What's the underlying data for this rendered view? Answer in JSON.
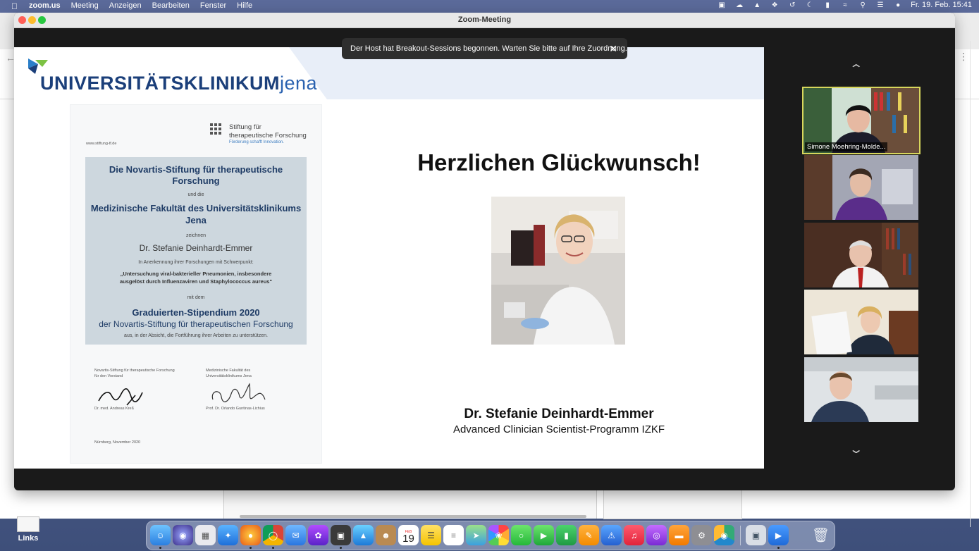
{
  "menubar": {
    "app_name": "zoom.us",
    "menus": [
      "Meeting",
      "Anzeigen",
      "Bearbeiten",
      "Fenster",
      "Hilfe"
    ],
    "clock": "Fr. 19. Feb.  15:41"
  },
  "desktop": {
    "icon_label": "Links"
  },
  "zoom": {
    "window_title": "Zoom-Meeting",
    "banner_text": "Der Host hat Breakout-Sessions begonnen. Warten Sie bitte auf Ihre Zuordnung.",
    "slide": {
      "logo_main": "UNIVERSITÄTSKLINIKUM",
      "logo_city": "jena",
      "headline": "Herzlichen Glückwunsch!",
      "person_name": "Dr. Stefanie Deinhardt-Emmer",
      "program": "Advanced Clinician Scientist-Programm IZKF",
      "certificate": {
        "foundation_line1": "Stiftung für",
        "foundation_line2": "therapeutische Forschung",
        "foundation_slogan": "Förderung schafft Innovation.",
        "website": "www.stiftung-tf.de",
        "title": "Die Novartis-Stiftung für therapeutische Forschung",
        "und_die": "und die",
        "faculty": "Medizinische Fakultät des Universitätsklinikums Jena",
        "zeichnen": "zeichnen",
        "recipient": "Dr. Stefanie Deinhardt-Emmer",
        "recognition": "In Anerkennung ihrer Forschungen mit Schwerpunkt:",
        "topic_line1": "„Untersuchung viral-bakterieller Pneumonien, insbesondere",
        "topic_line2": "ausgelöst durch Influenzaviren und Staphylococcus aureus\"",
        "mit_dem": "mit dem",
        "award": "Graduierten-Stipendium 2020",
        "award_by": "der Novartis-Stiftung für therapeutischen Forschung",
        "intent": "aus, in der Absicht, die Fortführung ihrer Arbeiten zu unterstützen.",
        "sig_left_line1": "Novartis-Stiftung für therapeutische Forschung",
        "sig_left_line2": "für den Vorstand",
        "sig_left_name": "Dr. med. Andreas Kreß",
        "sig_right_line1": "Medizinische Fakultät des",
        "sig_right_line2": "Universitätsklinikums Jena",
        "sig_right_name": "Prof. Dr. Orlando Guntinas-Lichius",
        "place_date": "Nürnberg, November 2020"
      }
    },
    "participants": [
      {
        "name": "Simone Moehring-Molde...",
        "active": true
      },
      {
        "name": "",
        "active": false
      },
      {
        "name": "",
        "active": false
      },
      {
        "name": "",
        "active": false
      },
      {
        "name": "",
        "active": false
      }
    ]
  },
  "dock": {
    "calendar_month": "FEB",
    "calendar_day": "19"
  },
  "colors": {
    "brand_blue": "#1b3f7a",
    "accent_green": "#28a745",
    "active_speaker_border": "#d7d65c"
  }
}
